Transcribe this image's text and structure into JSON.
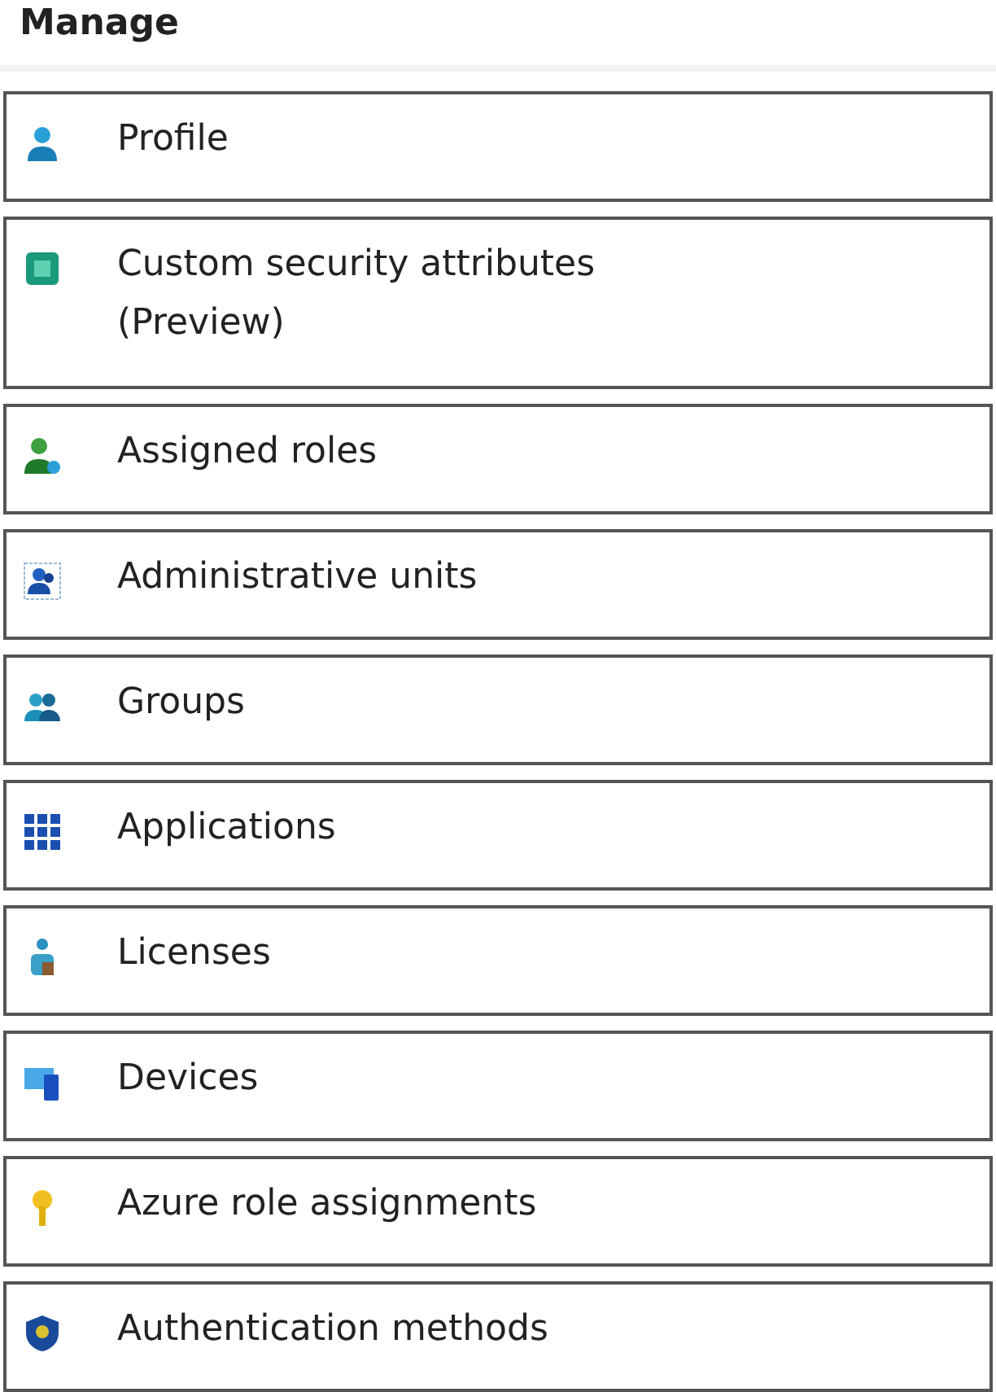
{
  "heading": "Manage",
  "items": [
    {
      "label": "Profile",
      "kind": "person"
    },
    {
      "label": "Custom security attributes\n(Preview)",
      "kind": "attributes"
    },
    {
      "label": "Assigned roles",
      "kind": "roles"
    },
    {
      "label": "Administrative units",
      "kind": "units"
    },
    {
      "label": "Groups",
      "kind": "groups"
    },
    {
      "label": "Applications",
      "kind": "apps"
    },
    {
      "label": "Licenses",
      "kind": "licenses"
    },
    {
      "label": "Devices",
      "kind": "devices"
    },
    {
      "label": "Azure role assignments",
      "kind": "key"
    },
    {
      "label": "Authentication methods",
      "kind": "shield"
    }
  ]
}
